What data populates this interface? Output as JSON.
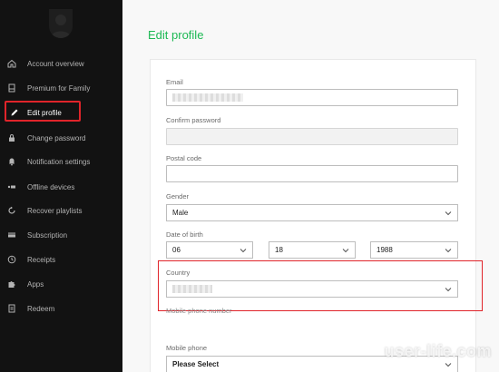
{
  "sidebar": {
    "items": [
      {
        "label": "Account overview",
        "icon": "home-icon"
      },
      {
        "label": "Premium for Family",
        "icon": "device-icon"
      },
      {
        "label": "Edit profile",
        "icon": "pencil-icon",
        "active": true
      },
      {
        "label": "Change password",
        "icon": "lock-icon"
      },
      {
        "label": "Notification settings",
        "icon": "bell-icon"
      },
      {
        "label": "Offline devices",
        "icon": "offline-devices-icon"
      },
      {
        "label": "Recover playlists",
        "icon": "recover-icon"
      },
      {
        "label": "Subscription",
        "icon": "card-icon"
      },
      {
        "label": "Receipts",
        "icon": "clock-icon"
      },
      {
        "label": "Apps",
        "icon": "puzzle-icon"
      },
      {
        "label": "Redeem",
        "icon": "redeem-icon"
      }
    ]
  },
  "main": {
    "title": "Edit profile",
    "form": {
      "email_label": "Email",
      "confirm_password_label": "Confirm password",
      "postal_code_label": "Postal code",
      "gender_label": "Gender",
      "gender_value": "Male",
      "dob_label": "Date of birth",
      "dob_day": "06",
      "dob_month": "18",
      "dob_year": "1988",
      "country_label": "Country",
      "mobile_number_label": "Mobile phone number",
      "mobile_phone_label": "Mobile phone",
      "mobile_phone_value": "Please Select"
    }
  },
  "watermark": "user-life.com",
  "colors": {
    "accent": "#1db954",
    "sidebar_bg": "#121212",
    "highlight": "#e0242a"
  }
}
